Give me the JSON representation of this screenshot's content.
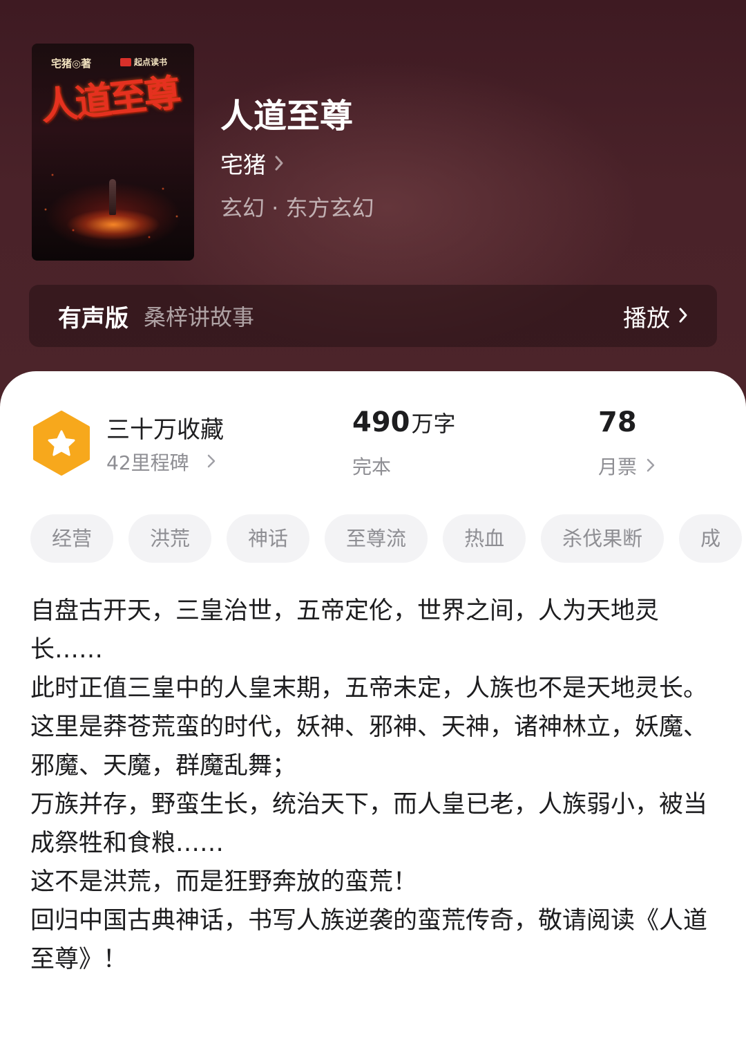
{
  "header": {
    "cover": {
      "author_mark": "宅猪◎著",
      "publisher": "起点读书",
      "title_art": "人道至尊"
    },
    "title": "人道至尊",
    "author": "宅猪",
    "genre": "玄幻 · 东方玄幻"
  },
  "audio": {
    "label": "有声版",
    "narrator": "桑梓讲故事",
    "play_label": "播放"
  },
  "stats": {
    "favorites": "三十万收藏",
    "milestones": "42里程碑",
    "word_count": "490",
    "word_unit": "万字",
    "status": "完本",
    "monthly_votes": "78",
    "monthly_votes_label": "月票"
  },
  "tags": [
    "经营",
    "洪荒",
    "神话",
    "至尊流",
    "热血",
    "杀伐果断",
    "成"
  ],
  "description": [
    "自盘古开天，三皇治世，五帝定伦，世界之间，人为天地灵长……",
    "此时正值三皇中的人皇末期，五帝未定，人族也不是天地灵长。",
    "这里是莽苍荒蛮的时代，妖神、邪神、天神，诸神林立，妖魔、邪魔、天魔，群魔乱舞；",
    "万族并存，野蛮生长，统治天下，而人皇已老，人族弱小，被当成祭牲和食粮……",
    "这不是洪荒，而是狂野奔放的蛮荒！",
    "回归中国古典神话，书写人族逆袭的蛮荒传奇，敬请阅读《人道至尊》！"
  ],
  "colors": {
    "hero_bg": "#4a2229",
    "badge": "#f7a81c",
    "tag_bg": "#f3f3f5",
    "muted_text": "#8e8e93"
  }
}
